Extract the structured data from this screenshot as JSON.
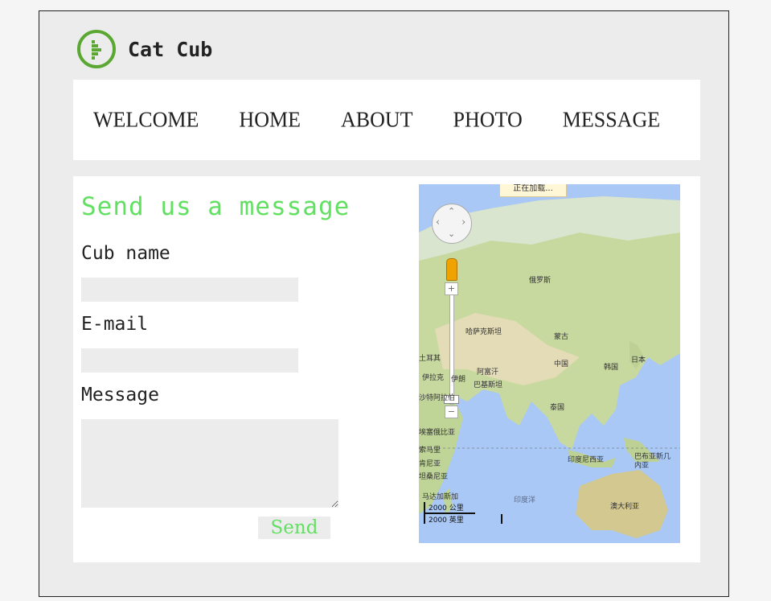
{
  "brand": {
    "name": "Cat Cub"
  },
  "nav": {
    "items": [
      "WELCOME",
      "HOME",
      "ABOUT",
      "PHOTO",
      "MESSAGE"
    ]
  },
  "form": {
    "title": "Send us a message",
    "cub_name_label": "Cub name",
    "email_label": "E-mail",
    "message_label": "Message",
    "send_label": "Send"
  },
  "map": {
    "loading_text": "正在加载...",
    "labels": {
      "russia": "俄罗斯",
      "kazakhstan": "哈萨克斯坦",
      "mongolia": "蒙古",
      "china": "中国",
      "japan": "日本",
      "korea": "韩国",
      "afghanistan": "阿富汗",
      "pakistan": "巴基斯坦",
      "iran": "伊朗",
      "iraq": "伊拉克",
      "saudi": "沙特阿拉伯",
      "thailand": "泰国",
      "indonesia": "印度尼西亚",
      "png": "巴布亚新几内亚",
      "australia": "澳大利亚",
      "indian_ocean": "印度洋",
      "ethiopia": "埃塞俄比亚",
      "somalia": "索马里",
      "madagascar": "马达加斯加",
      "turkey": "土耳其",
      "kenya": "肯尼亚",
      "tanzania": "坦桑尼亚"
    },
    "scale_top": "2000 公里",
    "scale_bottom": "2000 英里"
  },
  "colors": {
    "accent_green": "#62e062",
    "logo_green": "#5aa832",
    "frame_bg": "#ececec",
    "ocean": "#a9c8f5"
  }
}
